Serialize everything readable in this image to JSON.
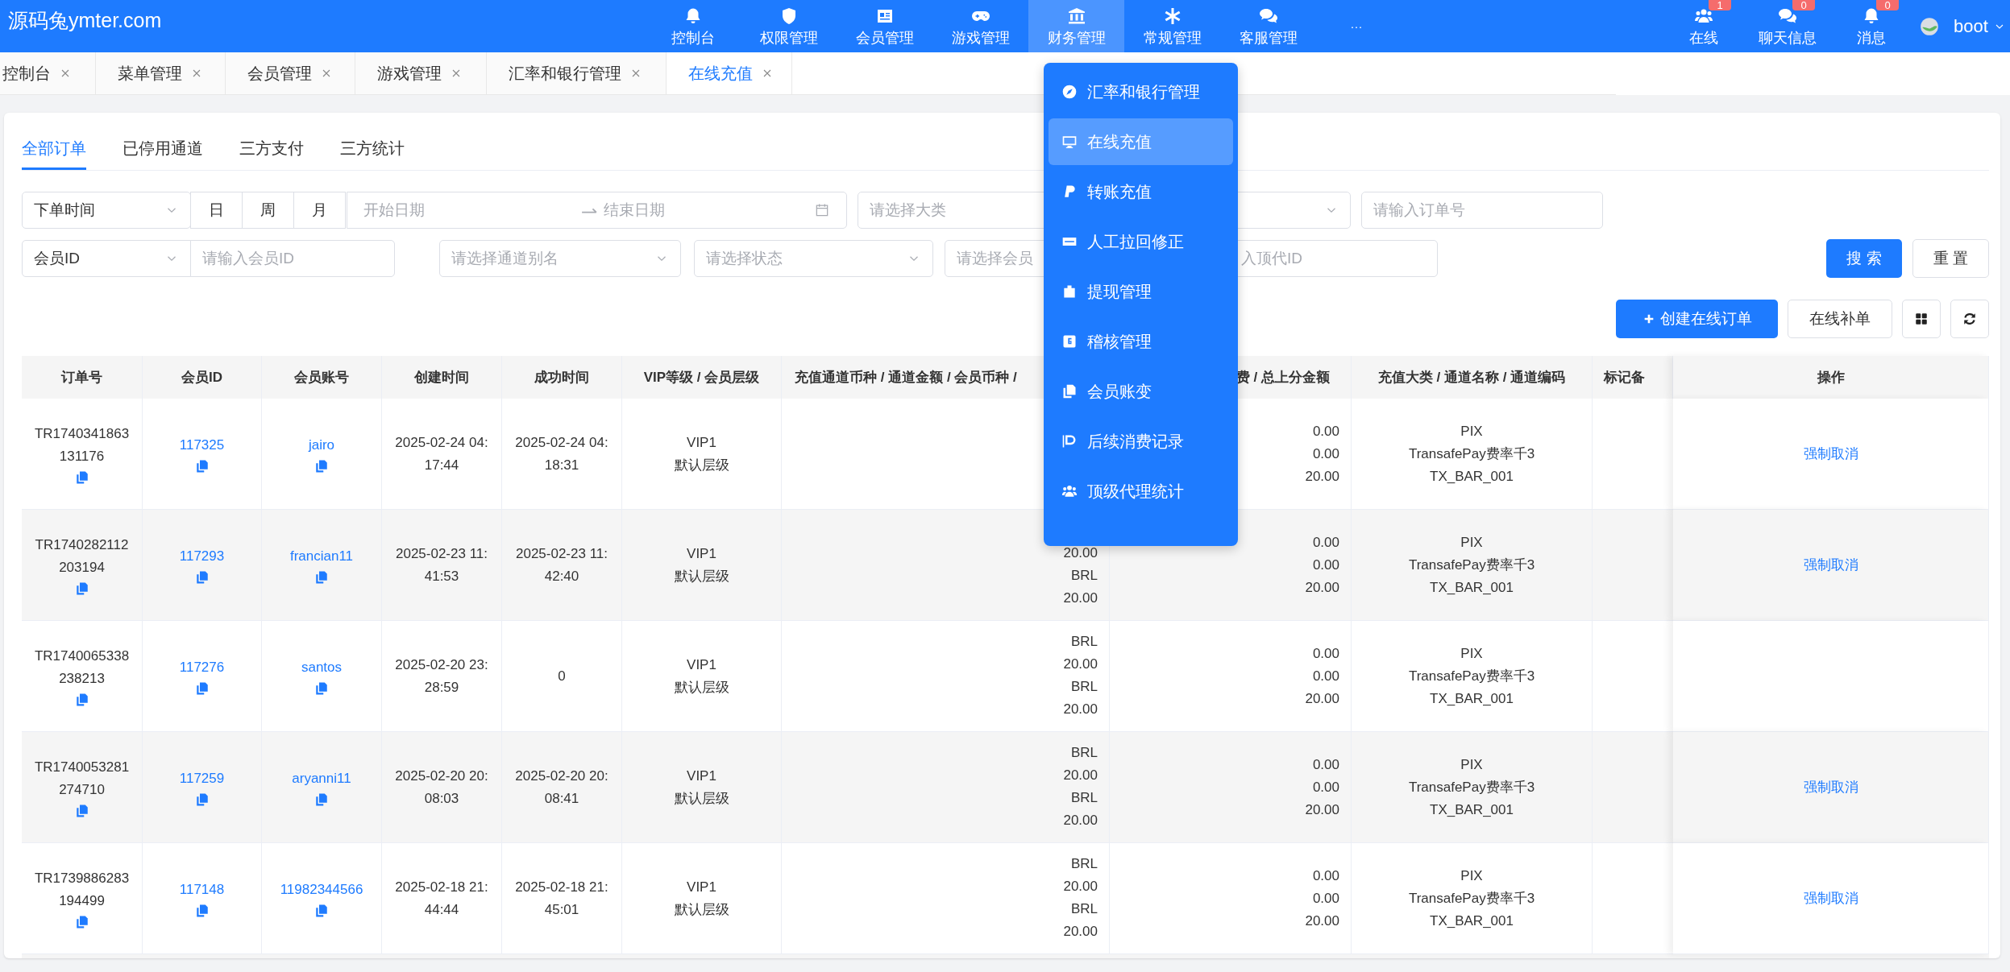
{
  "brand": "源码兔ymter.com",
  "nav": [
    {
      "label": "控制台",
      "selected": false
    },
    {
      "label": "权限管理",
      "selected": false
    },
    {
      "label": "会员管理",
      "selected": false
    },
    {
      "label": "游戏管理",
      "selected": false
    },
    {
      "label": "财务管理",
      "selected": true
    },
    {
      "label": "常规管理",
      "selected": false
    },
    {
      "label": "客服管理",
      "selected": false
    }
  ],
  "nav_more": "···",
  "header_actions": [
    {
      "label": "在线",
      "badge": "1"
    },
    {
      "label": "聊天信息",
      "badge": "0"
    },
    {
      "label": "消息",
      "badge": "0"
    }
  ],
  "user": {
    "name": "boot"
  },
  "open_tabs": [
    {
      "label": "控制台",
      "selected": false
    },
    {
      "label": "菜单管理",
      "selected": false
    },
    {
      "label": "会员管理",
      "selected": false
    },
    {
      "label": "游戏管理",
      "selected": false
    },
    {
      "label": "汇率和银行管理",
      "selected": false
    },
    {
      "label": "在线充值",
      "selected": true
    }
  ],
  "sub_tabs": [
    {
      "label": "全部订单",
      "selected": true
    },
    {
      "label": "已停用通道",
      "selected": false
    },
    {
      "label": "三方支付",
      "selected": false
    },
    {
      "label": "三方统计",
      "selected": false
    }
  ],
  "filters": {
    "row_1": [
      {
        "kind": "select",
        "value": "下单时间"
      },
      {
        "kind": "segmented",
        "options": [
          "日",
          "周",
          "月"
        ]
      },
      {
        "kind": "date_range",
        "start_placeholder": "开始日期",
        "end_placeholder": "结束日期"
      },
      {
        "kind": "select",
        "placeholder": "请选择大类"
      },
      {
        "kind": "select"
      },
      {
        "kind": "input",
        "placeholder": "请输入订单号"
      }
    ],
    "row_2": [
      {
        "kind": "select_input",
        "value": "会员ID",
        "placeholder": "请输入会员ID"
      },
      {
        "kind": "select",
        "placeholder": "请选择通道别名"
      },
      {
        "kind": "select",
        "placeholder": "请选择状态"
      },
      {
        "kind": "select",
        "placeholder": "请选择会员"
      },
      {
        "kind": "input",
        "placeholder": "入顶代ID"
      }
    ]
  },
  "search_button": "搜 索",
  "reset_button": "重 置",
  "toolbar": {
    "create_button": "创建在线订单",
    "supplement_button": "在线补单"
  },
  "table": {
    "columns": [
      "订单号",
      "会员ID",
      "会员账号",
      "创建时间",
      "成功时间",
      "VIP等级 / 会员层级",
      "充值通道币种 / 通道金额 / 会员币种 /",
      "费 / 总上分金额",
      "充值大类 / 通道名称 / 通道编码",
      "标记备",
      "操作"
    ],
    "rows": [
      {
        "order_no": "TR1740341863131176",
        "member_id": "117325",
        "account": "jairo",
        "created": "2025-02-24 04:17:44",
        "succeeded": "2025-02-24 04:18:31",
        "vip": "VIP1",
        "tier": "默认层级",
        "fees": [
          "0.00",
          "0.00",
          "20.00"
        ],
        "category": [
          "PIX",
          "TransafePay费率千3",
          "TX_BAR_001"
        ],
        "action": "强制取消"
      },
      {
        "order_no": "TR1740282112203194",
        "member_id": "117293",
        "account": "francian11",
        "created": "2025-02-23 11:41:53",
        "succeeded": "2025-02-23 11:42:40",
        "vip": "VIP1",
        "tier": "默认层级",
        "channel_amounts": [
          "20.00",
          "BRL",
          "20.00"
        ],
        "fees": [
          "0.00",
          "0.00",
          "20.00"
        ],
        "category": [
          "PIX",
          "TransafePay费率千3",
          "TX_BAR_001"
        ],
        "action": "强制取消"
      },
      {
        "order_no": "TR1740065338238213",
        "member_id": "117276",
        "account": "santos",
        "created": "2025-02-20 23:28:59",
        "succeeded": "0",
        "vip": "VIP1",
        "tier": "默认层级",
        "channel_amounts": [
          "BRL",
          "20.00",
          "BRL",
          "20.00"
        ],
        "fees": [
          "0.00",
          "0.00",
          "20.00"
        ],
        "category": [
          "PIX",
          "TransafePay费率千3",
          "TX_BAR_001"
        ]
      },
      {
        "order_no": "TR1740053281274710",
        "member_id": "117259",
        "account": "aryanni11",
        "created": "2025-02-20 20:08:03",
        "succeeded": "2025-02-20 20:08:41",
        "vip": "VIP1",
        "tier": "默认层级",
        "channel_amounts": [
          "BRL",
          "20.00",
          "BRL",
          "20.00"
        ],
        "fees": [
          "0.00",
          "0.00",
          "20.00"
        ],
        "category": [
          "PIX",
          "TransafePay费率千3",
          "TX_BAR_001"
        ],
        "action": "强制取消"
      },
      {
        "order_no": "TR1739886283194499",
        "member_id": "117148",
        "account": "11982344566",
        "created": "2025-02-18 21:44:44",
        "succeeded": "2025-02-18 21:45:01",
        "vip": "VIP1",
        "tier": "默认层级",
        "channel_amounts": [
          "BRL",
          "20.00",
          "BRL",
          "20.00"
        ],
        "fees": [
          "0.00",
          "0.00",
          "20.00"
        ],
        "category": [
          "PIX",
          "TransafePay费率千3",
          "TX_BAR_001"
        ],
        "action": "强制取消"
      }
    ]
  },
  "dropdown_menu": [
    {
      "label": "汇率和银行管理",
      "selected": false
    },
    {
      "label": "在线充值",
      "selected": true
    },
    {
      "label": "转账充值",
      "selected": false
    },
    {
      "label": "人工拉回修正",
      "selected": false
    },
    {
      "label": "提现管理",
      "selected": false
    },
    {
      "label": "稽核管理",
      "selected": false
    },
    {
      "label": "会员账变",
      "selected": false
    },
    {
      "label": "后续消费记录",
      "selected": false
    },
    {
      "label": "顶级代理统计",
      "selected": false
    }
  ]
}
